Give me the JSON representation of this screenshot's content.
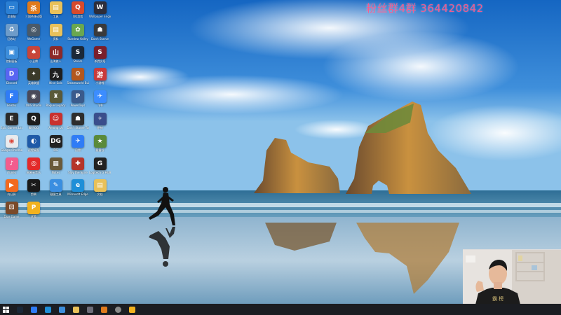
{
  "watermark": {
    "text": "粉丝群4群 364420842",
    "color": "#ff5a8c"
  },
  "desktop_icons": [
    {
      "label": "此电脑",
      "icon": "this-pc-icon",
      "color": "#2a7fd4",
      "glyph": "▭"
    },
    {
      "label": "三国杀移动版",
      "icon": "sanguosha-icon",
      "color": "#e07a1c",
      "glyph": "杀"
    },
    {
      "label": "工具",
      "icon": "folder-icon",
      "color": "#e9c15a",
      "glyph": "▤"
    },
    {
      "label": "QQ游戏",
      "icon": "qq-game-icon",
      "color": "#d84a2b",
      "glyph": "Q"
    },
    {
      "label": "Wallpaper Engine",
      "icon": "wallpaper-engine-icon",
      "color": "#2d2d3a",
      "glyph": "W"
    },
    {
      "label": "回收站",
      "icon": "recycle-bin-icon",
      "color": "#6e9cc9",
      "glyph": "♻"
    },
    {
      "label": "WeGame",
      "icon": "wegame-icon",
      "color": "#4a5a6a",
      "glyph": "◎"
    },
    {
      "label": "资料",
      "icon": "folder-icon",
      "color": "#e9c15a",
      "glyph": "▤"
    },
    {
      "label": "Stardew Valley",
      "icon": "stardew-icon",
      "color": "#6aa84f",
      "glyph": "✿"
    },
    {
      "label": "Don't Starve",
      "icon": "dont-starve-icon",
      "color": "#3a3a3a",
      "glyph": "☗"
    },
    {
      "label": "控制面板",
      "icon": "control-panel-icon",
      "color": "#3d8edb",
      "glyph": "▣"
    },
    {
      "label": "小丑牌",
      "icon": "balatro-icon",
      "color": "#c8453a",
      "glyph": "♠"
    },
    {
      "label": "山海旅人",
      "icon": "game-icon",
      "color": "#8c2a2a",
      "glyph": "山"
    },
    {
      "label": "Steam",
      "icon": "steam-icon",
      "color": "#1b2838",
      "glyph": "S"
    },
    {
      "label": "杀戮尖塔",
      "icon": "slay-the-spire-icon",
      "color": "#7a1f2b",
      "glyph": "S"
    },
    {
      "label": "Discord",
      "icon": "discord-icon",
      "color": "#5865f2",
      "glyph": "D"
    },
    {
      "label": "英雄联盟",
      "icon": "lol-icon",
      "color": "#3a3a2a",
      "glyph": "✦"
    },
    {
      "label": "Nine Sols",
      "icon": "game-icon",
      "color": "#1f1f1f",
      "glyph": "九"
    },
    {
      "label": "Steamworld Build",
      "icon": "game-icon",
      "color": "#b3571d",
      "glyph": "⚙"
    },
    {
      "label": "小游戏",
      "icon": "game-icon",
      "color": "#c93a3a",
      "glyph": "游"
    },
    {
      "label": "Feishu",
      "icon": "feishu-icon",
      "color": "#2f7cf6",
      "glyph": "F"
    },
    {
      "label": "OBS Studio",
      "icon": "obs-icon",
      "color": "#4a4a5a",
      "glyph": "◉"
    },
    {
      "label": "Rogue Legacy",
      "icon": "game-icon",
      "color": "#5a5a3a",
      "glyph": "♜"
    },
    {
      "label": "PowerToys",
      "icon": "powertoys-icon",
      "color": "#3a5a8c",
      "glyph": "P"
    },
    {
      "label": "飞书",
      "icon": "feishu-icon",
      "color": "#3c8dff",
      "glyph": "✈"
    },
    {
      "label": "Epic Games Launcher",
      "icon": "epic-icon",
      "color": "#2a2a2a",
      "glyph": "E"
    },
    {
      "label": "腾讯QQ",
      "icon": "qq-icon",
      "color": "#1d1d1d",
      "glyph": "Q"
    },
    {
      "label": "Among Us",
      "icon": "among-us-icon",
      "color": "#c8312f",
      "glyph": "☺"
    },
    {
      "label": "Don't Starve Together",
      "icon": "dst-icon",
      "color": "#2e2e2e",
      "glyph": "☗"
    },
    {
      "label": "原神",
      "icon": "genshin-icon",
      "color": "#3a4e8c",
      "glyph": "✧"
    },
    {
      "label": "Google Chrome",
      "icon": "chrome-icon",
      "color": "#e8eaed",
      "glyph": "◉"
    },
    {
      "label": "远程桌面",
      "icon": "remote-icon",
      "color": "#1e5aa8",
      "glyph": "◐"
    },
    {
      "label": "DG",
      "icon": "dg-icon",
      "color": "#222222",
      "glyph": "DG"
    },
    {
      "label": "迅雷",
      "icon": "xunlei-icon",
      "color": "#2f7cf6",
      "glyph": "✈"
    },
    {
      "label": "星露谷",
      "icon": "game-icon",
      "color": "#5a8a3a",
      "glyph": "★"
    },
    {
      "label": "iTunes",
      "icon": "itunes-icon",
      "color": "#f25d8e",
      "glyph": "♪"
    },
    {
      "label": "网易云音乐",
      "icon": "netease-music-icon",
      "color": "#e22a2a",
      "glyph": "◎"
    },
    {
      "label": "Notes",
      "icon": "notes-icon",
      "color": "#6a5a3a",
      "glyph": "▦"
    },
    {
      "label": "Slay the Spire",
      "icon": "game-icon",
      "color": "#b5352a",
      "glyph": "✚"
    },
    {
      "label": "Logitech G HUB",
      "icon": "ghub-icon",
      "color": "#222222",
      "glyph": "G"
    },
    {
      "label": "向日葵",
      "icon": "sunlogin-icon",
      "color": "#f26a1f",
      "glyph": "▶"
    },
    {
      "label": "剪映",
      "icon": "capcut-icon",
      "color": "#1a1a1a",
      "glyph": "✂"
    },
    {
      "label": "截图工具",
      "icon": "snip-icon",
      "color": "#3a8ee0",
      "glyph": "✎"
    },
    {
      "label": "Microsoft Edge",
      "icon": "edge-icon",
      "color": "#1f8fd8",
      "glyph": "e"
    },
    {
      "label": "文档",
      "icon": "folder-icon",
      "color": "#e9c15a",
      "glyph": "▤"
    },
    {
      "label": "Dice Game",
      "icon": "game-icon",
      "color": "#7a4a2a",
      "glyph": "⚄"
    },
    {
      "label": "优酷",
      "icon": "youku-icon",
      "color": "#f2b21f",
      "glyph": "P"
    }
  ],
  "taskbar": [
    {
      "icon": "start-icon",
      "color": "#ffffff"
    },
    {
      "icon": "steam-icon",
      "color": "#1b2838"
    },
    {
      "icon": "browser-icon",
      "color": "#2f7cf6"
    },
    {
      "icon": "edge-icon",
      "color": "#1f8fd8"
    },
    {
      "icon": "settings-icon",
      "color": "#3d8edb"
    },
    {
      "icon": "file-explorer-icon",
      "color": "#e9c15a"
    },
    {
      "icon": "terminal-icon",
      "color": "#6e6e7a"
    },
    {
      "icon": "game-icon",
      "color": "#e07a1c"
    },
    {
      "icon": "obs-icon",
      "color": "#8a8a8a"
    },
    {
      "icon": "app-icon",
      "color": "#f2b21f"
    }
  ]
}
